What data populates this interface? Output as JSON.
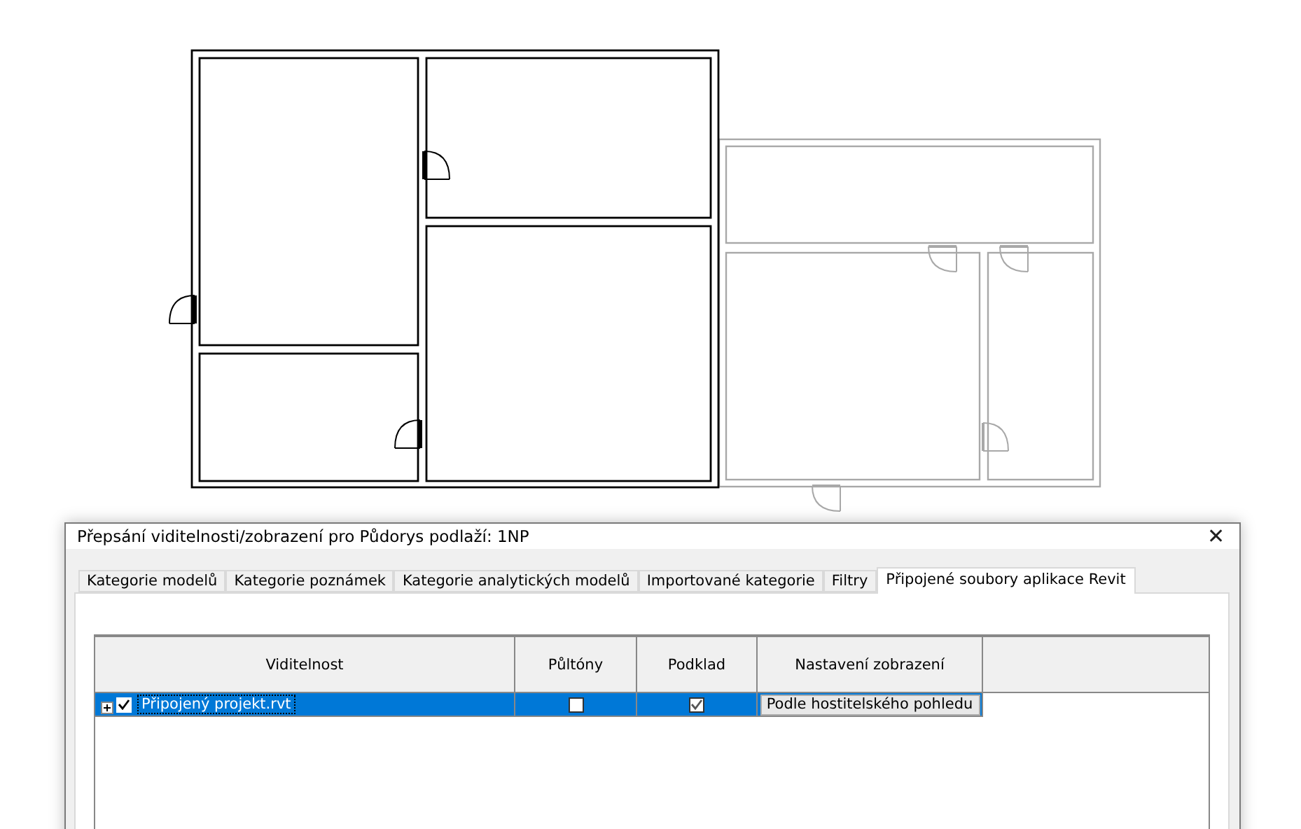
{
  "dialog": {
    "title": "Přepsání viditelnosti/zobrazení pro Půdorys podlaží: 1NP",
    "close": "✕"
  },
  "tabs": [
    {
      "label": "Kategorie modelů",
      "selected": false
    },
    {
      "label": "Kategorie poznámek",
      "selected": false
    },
    {
      "label": "Kategorie analytických modelů",
      "selected": false
    },
    {
      "label": "Importované kategorie",
      "selected": false
    },
    {
      "label": "Filtry",
      "selected": false
    },
    {
      "label": "Připojené soubory aplikace Revit",
      "selected": true
    }
  ],
  "table": {
    "columns": [
      "Viditelnost",
      "Půltóny",
      "Podklad",
      "Nastavení zobrazení"
    ],
    "rows": [
      {
        "name": "Připojený projekt.rvt",
        "selected": true,
        "expanded": false,
        "visible": true,
        "halftone": false,
        "underlay": true,
        "display": "Podle hostitelského pohledu"
      }
    ]
  }
}
